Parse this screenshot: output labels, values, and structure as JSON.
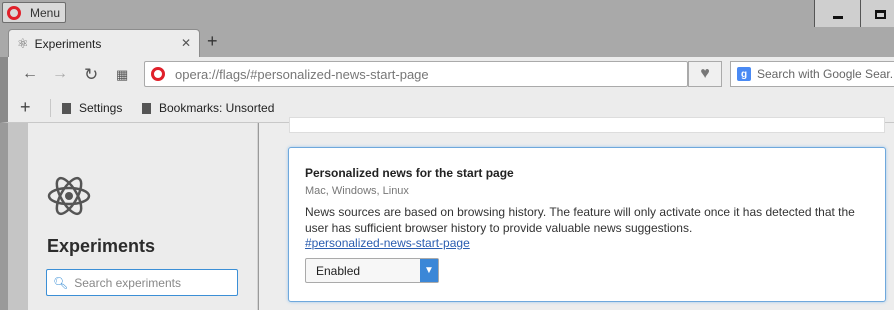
{
  "window": {
    "menu_label": "Menu"
  },
  "tabs": [
    {
      "title": "Experiments"
    }
  ],
  "toolbar": {
    "url": "opera://flags/#personalized-news-start-page",
    "search_placeholder": "Search with Google Sear..."
  },
  "bookmarks": [
    {
      "label": "Settings"
    },
    {
      "label": "Bookmarks: Unsorted"
    }
  ],
  "sidebar": {
    "title": "Experiments",
    "search_placeholder": "Search experiments"
  },
  "experiment": {
    "title": "Personalized news for the start page",
    "platforms": "Mac, Windows, Linux",
    "description": "News sources are based on browsing history. The feature will only activate once it has detected that the user has sufficient browser history to provide valuable news suggestions.",
    "link": "#personalized-news-start-page",
    "selected": "Enabled"
  },
  "colors": {
    "accent": "#3b87d7",
    "opera_red": "#e0202a"
  }
}
